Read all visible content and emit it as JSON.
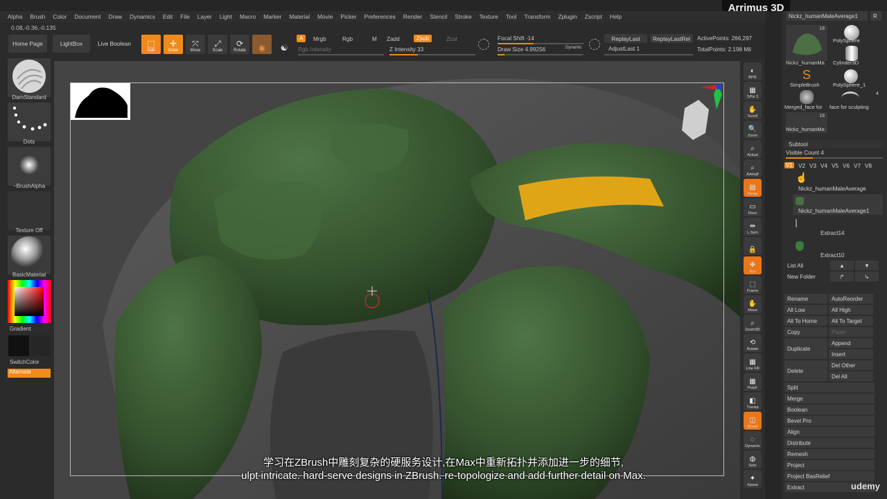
{
  "logo": "Arrimus 3D",
  "menu": [
    "Alpha",
    "Brush",
    "Color",
    "Document",
    "Draw",
    "Dynamics",
    "Edit",
    "File",
    "Layer",
    "Light",
    "Macro",
    "Marker",
    "Material",
    "Movie",
    "Picker",
    "Preferences",
    "Render",
    "Stencil",
    "Stroke",
    "Texture",
    "Tool",
    "Transform",
    "Zplugin",
    "Zscript",
    "Help"
  ],
  "coords": "0.08,-0.36,-0.135",
  "shelf": {
    "home_page": "Home Page",
    "lightbox": "LightBox",
    "live_boolean": "Live Boolean",
    "edit": "Edit",
    "draw": "Draw",
    "move": "Move",
    "scale": "Scale",
    "rotate": "Rotate",
    "a_tag": "A",
    "mrgb": "Mrgb",
    "rgb": "Rgb",
    "m": "M",
    "zadd": "Zadd",
    "zsub": "Zsub",
    "zcut": "Zcut",
    "rgb_intensity": "Rgb Intensity",
    "z_intensity": "Z Intensity 33",
    "focal_shift": "Focal Shift -14",
    "draw_size": "Draw Size 4.99256",
    "dynamic": "Dynamic",
    "replay_last": "ReplayLast",
    "replay_last_rel": "ReplayLastRel",
    "adjust_last": "AdjustLast 1",
    "active_points": "ActivePoints: 266,297",
    "total_points": "TotalPoints: 2.198 Mil",
    "z_intensity_level": 0.33
  },
  "left": {
    "brush": "DamStandard",
    "stroke": "Dots",
    "alpha": "~BrushAlpha",
    "texture": "Texture Off",
    "material": "BasicMaterial",
    "gradient": "Gradient",
    "switch_color": "SwitchColor",
    "alternate": "Alternate"
  },
  "rightbar": [
    {
      "label": "BPR",
      "icon": "render-icon"
    },
    {
      "label": "SPix 3",
      "icon": "spix-icon"
    },
    {
      "label": "Scroll",
      "icon": "hand-icon"
    },
    {
      "label": "Zoom",
      "icon": "zoom-icon"
    },
    {
      "label": "Actual",
      "icon": "actual-icon"
    },
    {
      "label": "AAHalf",
      "icon": "aahalf-icon"
    },
    {
      "label": "Persp",
      "icon": "persp-icon"
    },
    {
      "label": "Floor",
      "icon": "floor-icon"
    },
    {
      "label": "L.Sym",
      "icon": "lsym-icon"
    },
    {
      "label": "",
      "icon": "lock-icon"
    },
    {
      "label": "Xyz",
      "icon": "xyz-icon"
    },
    {
      "label": "Frame",
      "icon": "frame-icon"
    },
    {
      "label": "Move",
      "icon": "move-icon"
    },
    {
      "label": "Zoom3D",
      "icon": "zoom3d-icon"
    },
    {
      "label": "Rotate",
      "icon": "rotate-icon"
    },
    {
      "label": "Line Fill",
      "icon": "linefill-icon"
    },
    {
      "label": "PolyF",
      "icon": "polyf-icon"
    },
    {
      "label": "Transp",
      "icon": "transp-icon"
    },
    {
      "label": "Ghost",
      "icon": "ghost-icon"
    },
    {
      "label": "Dynamic",
      "icon": "dynamic-icon"
    },
    {
      "label": "Solo",
      "icon": "solo-icon"
    },
    {
      "label": "Xpose",
      "icon": "xpose-icon"
    }
  ],
  "tool": {
    "current": "Nickz_humanMaleAverage1",
    "r": "R",
    "items": [
      {
        "label": "Nickz_humanMa",
        "count": "18"
      },
      {
        "label": "PolySphere",
        "count": ""
      },
      {
        "label": "Cylinder3D",
        "count": ""
      },
      {
        "label": "SimpleBrush",
        "count": ""
      },
      {
        "label": "PolySphere_1",
        "count": ""
      },
      {
        "label": "Merged_face for",
        "count": ""
      },
      {
        "label": "face for sculpting",
        "count": "4"
      },
      {
        "label": "Nickz_humanMa",
        "count": "18"
      }
    ]
  },
  "subtool": {
    "title": "Subtool",
    "visible_count": "Visible Count 4",
    "versions": [
      "V1",
      "V2",
      "V3",
      "V4",
      "V5",
      "V6",
      "V7",
      "V8"
    ],
    "items": [
      "Nickz_humanMaleAverage",
      "Nickz_humanMaleAverage1",
      "Extract14",
      "Extract10"
    ],
    "list_all": "List All",
    "new_folder": "New Folder",
    "rename": "Rename",
    "auto_reorder": "AutoReorder",
    "all_low": "All Low",
    "all_high": "All High",
    "all_to_home": "All To Home",
    "all_to_target": "All To Target",
    "copy": "Copy",
    "paste": "Paste",
    "duplicate": "Duplicate",
    "append": "Append",
    "insert": "Insert",
    "delete": "Delete",
    "del_other": "Del Other",
    "del_all": "Del All",
    "more": [
      "Split",
      "Merge",
      "Boolean",
      "Bevel Pro",
      "Align",
      "Distribute",
      "Remesh",
      "Project",
      "Project BasRelief",
      "Extract"
    ]
  },
  "subtitles": {
    "chinese": "学习在ZBrush中雕刻复杂的硬服务设计,在Max中重新拓扑并添加进一步的细节,",
    "english": "ulpt intricate. hard-serve designs in ZBrush. re-topologize and add further detail on Max."
  },
  "watermark": "udemy",
  "colors": {
    "accent": "#f08a1c",
    "armor": "#3b5a33",
    "highlight": "#e0a516",
    "background": "#444444"
  }
}
